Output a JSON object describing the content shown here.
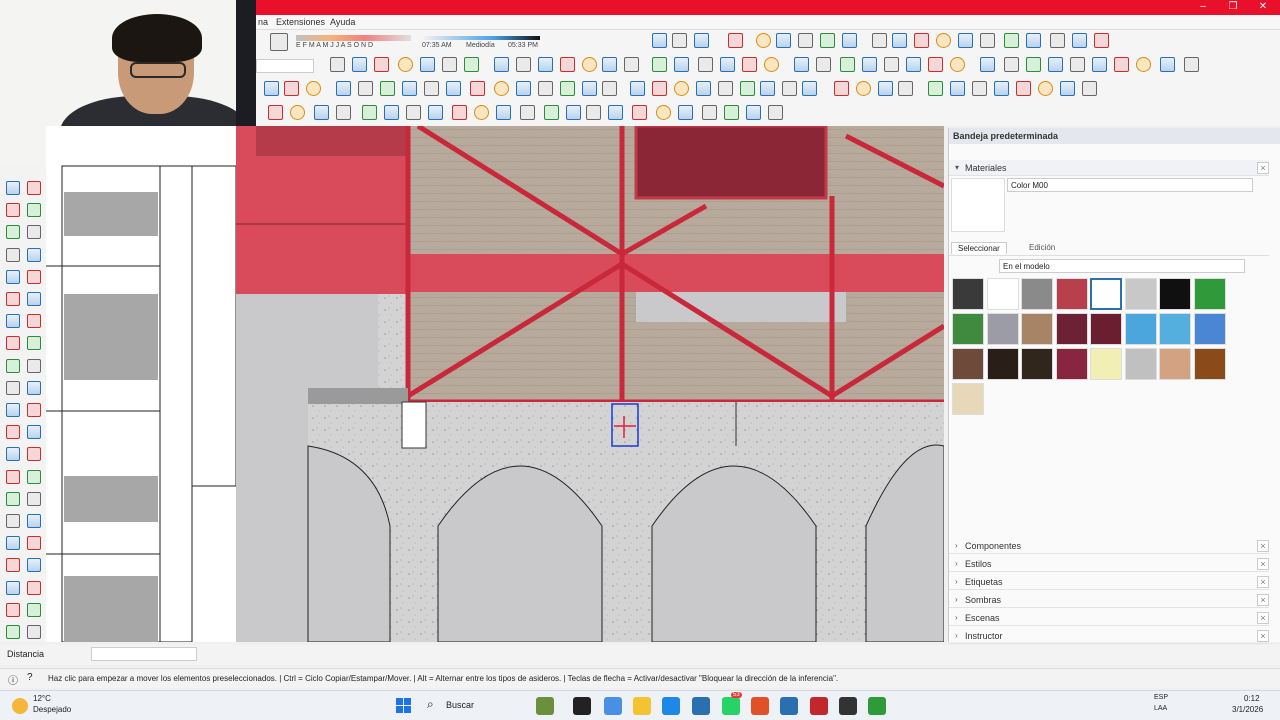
{
  "menubar": {
    "items": [
      "na",
      "Extensiones",
      "Ayuda"
    ]
  },
  "shadow_toolbar": {
    "months": "E F M A M J J A S O N D",
    "time_start": "07:35 AM",
    "noon": "Mediodía",
    "time_end": "05:33 PM"
  },
  "window_controls": {
    "minimize": "–",
    "restore": "❐",
    "close": "✕"
  },
  "tray": {
    "title": "Bandeja predeterminada",
    "materials_section": "Materiales",
    "material_name": "Color M00",
    "tabs": [
      "Seleccionar",
      "Edición"
    ],
    "collection": "En el modelo",
    "swatch_colors": [
      "#3a3a3a",
      "#ffffff",
      "#8a8a8a",
      "#b8404c",
      "#ffffff",
      "#c8c8c8",
      "#101010",
      "#2e9a3a",
      "#3f8a3f",
      "#9c9ca6",
      "#a88466",
      "#6c2234",
      "#6a1e30",
      "#4aa6dc",
      "#54aede",
      "#4a86d4",
      "#6e4a3a",
      "#2a1f18",
      "#30261c",
      "#8a2540",
      "#f2efb4",
      "#c0c0c0",
      "#d2a282",
      "#8a4a1a",
      "#e6d8b8"
    ],
    "sections": [
      "Componentes",
      "Estilos",
      "Etiquetas",
      "Sombras",
      "Escenas",
      "Instructor"
    ]
  },
  "measurements": {
    "label": "Distancia",
    "value": ""
  },
  "status": {
    "message": "Haz clic para empezar a mover los elementos preseleccionados. | Ctrl = Ciclo Copiar/Estampar/Mover. | Alt = Alternar entre los tipos de asideros. | Teclas de flecha = Activar/desactivar \"Bloquear la dirección de la inferencia\"."
  },
  "taskbar": {
    "weather_temp": "12°C",
    "weather_desc": "Despejado",
    "search": "Buscar",
    "badge": "53",
    "lang_top": "ESP",
    "lang_bottom": "LAA",
    "time": "0:12",
    "date": "3/1/2026"
  },
  "colors": {
    "title_red": "#e8102a",
    "beam_red": "#d94a5a",
    "concrete": "#d0d0d0",
    "wood": "#b5a79a",
    "accent_blue": "#2a6fb0"
  }
}
